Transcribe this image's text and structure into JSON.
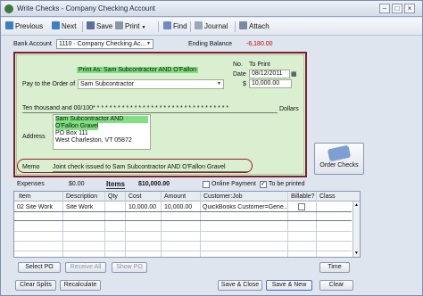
{
  "window": {
    "title": "Write Checks - Company Checking Account"
  },
  "toolbar": {
    "previous": "Previous",
    "next": "Next",
    "save": "Save",
    "print": "Print",
    "find": "Find",
    "journal": "Journal",
    "attach": "Attach"
  },
  "header": {
    "bank_account_label": "Bank Account",
    "bank_account_value": "1110 · Company Checking Ac...",
    "ending_balance_label": "Ending Balance",
    "ending_balance_value": "-6,180.00"
  },
  "check": {
    "print_as": "Print As: Sam Subcontractor AND O'Fallon",
    "no_label": "No.",
    "no_value": "To Print",
    "date_label": "Date",
    "date_value": "08/12/2011",
    "pay_to_label": "Pay to the Order of",
    "pay_to_value": "Sam Subcontractor",
    "currency_symbol": "$",
    "amount_value": "10,000.00",
    "amount_words": "Ten thousand  and 00/100* * * * * * * * * * * * * * * * * * * * * * * * * * * * * * * * *",
    "dollars_label": "Dollars",
    "address_label": "Address",
    "address_lines": [
      "Sam Subcontractor AND",
      "O'Fallon Gravel",
      "PO Box 111",
      "West Charleston, VT 05872"
    ],
    "memo_label": "Memo",
    "memo_value": "Joint check issued to Sam Subcontractor AND O'Fallon Gravel"
  },
  "order_checks_label": "Order Checks",
  "tabs": {
    "expenses_label": "Expenses",
    "expenses_amount": "$0.00",
    "items_label": "Items",
    "items_amount": "$10,000.00",
    "online_payment_label": "Online Payment",
    "to_be_printed_label": "To be printed",
    "to_be_printed_checked": true
  },
  "items_table": {
    "columns": [
      "Item",
      "Description",
      "Qty",
      "Cost",
      "Amount",
      "Customer:Job",
      "Billable?",
      "Class"
    ],
    "rows": [
      {
        "item": "02 Site Work",
        "description": "Site Work",
        "qty": "",
        "cost": "10,000.00",
        "amount": "10,000.00",
        "customer_job": "QuickBooks Customer=Gene...",
        "billable": false,
        "class": ""
      }
    ]
  },
  "item_buttons": {
    "select_po": "Select PO",
    "receive_all": "Receive All",
    "show_po": "Show PO",
    "time": "Time"
  },
  "footer_buttons": {
    "clear_splits": "Clear Splits",
    "recalculate": "Recalculate",
    "save_close": "Save & Close",
    "save_new": "Save & New",
    "clear": "Clear"
  },
  "colors": {
    "check_background": "#d9efd0",
    "highlight": "#7ee07e",
    "annotation_red": "#9b1c2c",
    "ending_balance": "#cc0000"
  }
}
